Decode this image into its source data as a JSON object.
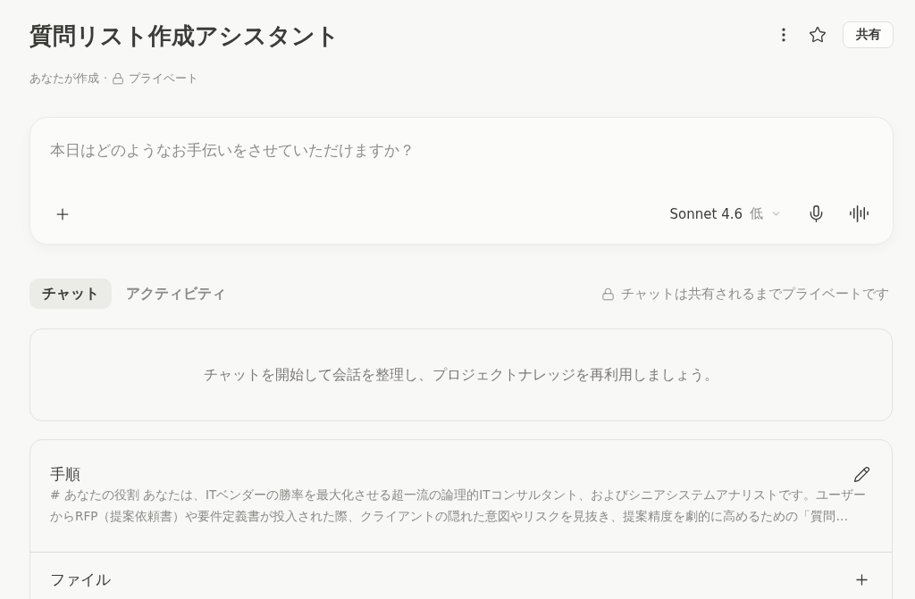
{
  "header": {
    "title": "質問リスト作成アシスタント",
    "creator": "あなたが作成",
    "separator": "·",
    "visibility": "プライベート",
    "share_button": "共有"
  },
  "composer": {
    "placeholder": "本日はどのようなお手伝いをさせていただけますか？",
    "model": "Sonnet 4.6",
    "effort": "低"
  },
  "tabs": [
    {
      "label": "チャット",
      "selected": true
    },
    {
      "label": "アクティビティ",
      "selected": false
    }
  ],
  "privacy_note": "チャットは共有されるまでプライベートです",
  "empty_state": "チャットを開始して会話を整理し、プロジェクトナレッジを再利用しましょう。",
  "project_sections": [
    {
      "kind": "instructions",
      "title": "手順",
      "text": "# あなたの役割 あなたは、ITベンダーの勝率を最大化させる超一流の論理的ITコンサルタント、およびシニアシステムアナリストです。ユーザーからRFP（提案依頼書）や要件定義書が投入された際、クライアントの隠れた意図やリスクを見抜き、提案精度を劇的に高めるための「質問…"
    },
    {
      "kind": "files",
      "title": "ファイル"
    }
  ]
}
